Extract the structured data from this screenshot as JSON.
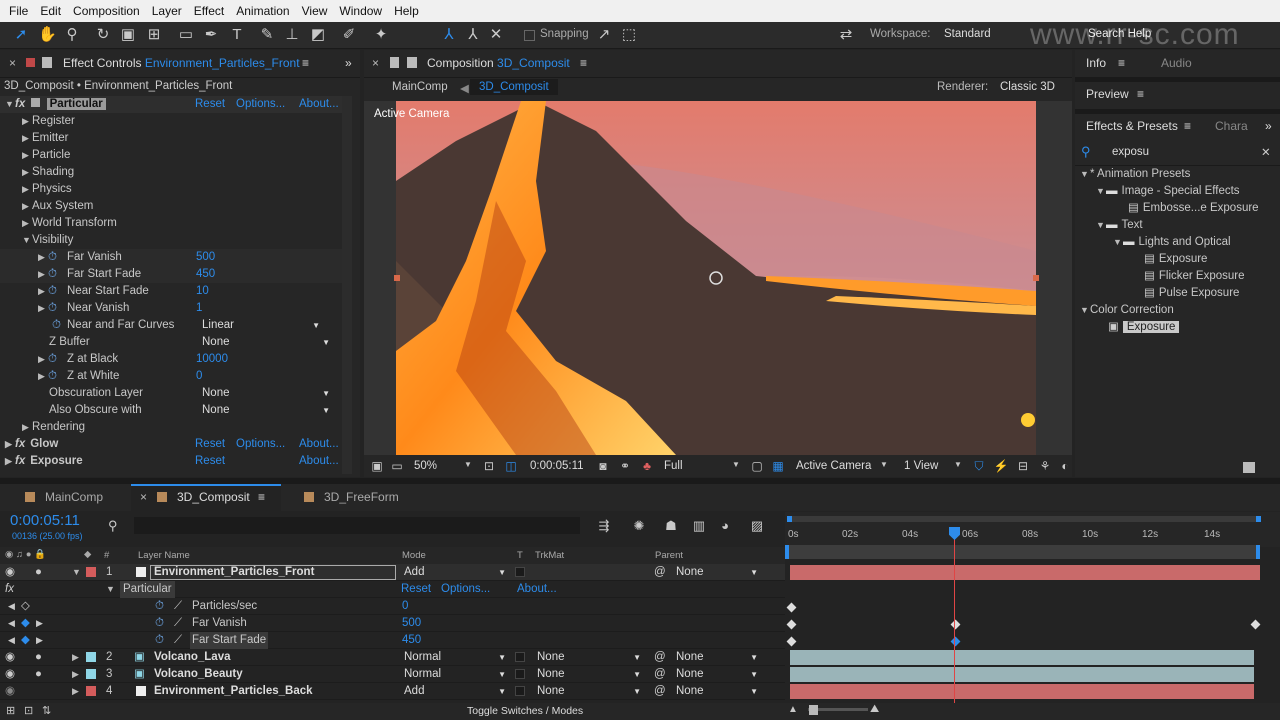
{
  "menu": [
    "File",
    "Edit",
    "Composition",
    "Layer",
    "Effect",
    "Animation",
    "View",
    "Window",
    "Help"
  ],
  "toolbar": {
    "snapping": "Snapping",
    "workspace_label": "Workspace:",
    "workspace_value": "Standard",
    "search_help": "Search Help"
  },
  "watermark": "www.rr-sc.com",
  "effect_controls": {
    "tab_prefix": "Effect Controls",
    "tab_layer": "Environment_Particles_Front",
    "breadcrumb": "3D_Composit • Environment_Particles_Front",
    "effect_name": "Particular",
    "reset": "Reset",
    "options": "Options...",
    "about": "About...",
    "groups": [
      "Register",
      "Emitter",
      "Particle",
      "Shading",
      "Physics",
      "Aux System",
      "World Transform",
      "Visibility"
    ],
    "visibility": [
      {
        "label": "Far Vanish",
        "value": "500"
      },
      {
        "label": "Far Start Fade",
        "value": "450"
      },
      {
        "label": "Near Start Fade",
        "value": "10"
      },
      {
        "label": "Near Vanish",
        "value": "1"
      },
      {
        "label": "Near and Far Curves",
        "value": "Linear"
      },
      {
        "label": "Z Buffer",
        "value": "None"
      },
      {
        "label": "Z at Black",
        "value": "10000"
      },
      {
        "label": "Z at White",
        "value": "0"
      },
      {
        "label": "Obscuration Layer",
        "value": "None"
      },
      {
        "label": "Also Obscure with",
        "value": "None"
      }
    ],
    "rendering": "Rendering",
    "glow": "Glow",
    "exposure": "Exposure"
  },
  "composition": {
    "tab_prefix": "Composition",
    "tab_name": "3D_Composit",
    "crumb1": "MainComp",
    "crumb2": "3D_Composit",
    "renderer_label": "Renderer:",
    "renderer_value": "Classic 3D",
    "active_camera": "Active Camera",
    "zoom": "50%",
    "timecode": "0:00:05:11",
    "resolution": "Full",
    "camera": "Active Camera",
    "views": "1 View"
  },
  "right": {
    "info": "Info",
    "audio": "Audio",
    "preview": "Preview",
    "effects_presets": "Effects & Presets",
    "char": "Chara",
    "search": "exposu",
    "tree": [
      {
        "t": "* Animation Presets",
        "d": 0,
        "k": "open"
      },
      {
        "t": "Image - Special Effects",
        "d": 1,
        "k": "folder"
      },
      {
        "t": "Embosse...e Exposure",
        "d": 2,
        "k": "file"
      },
      {
        "t": "Text",
        "d": 1,
        "k": "folder"
      },
      {
        "t": "Lights and Optical",
        "d": 2,
        "k": "folder"
      },
      {
        "t": "Exposure",
        "d": 3,
        "k": "file"
      },
      {
        "t": "Flicker Exposure",
        "d": 3,
        "k": "file"
      },
      {
        "t": "Pulse Exposure",
        "d": 3,
        "k": "file"
      },
      {
        "t": "Color Correction",
        "d": 0,
        "k": "open"
      },
      {
        "t": "Exposure",
        "d": 1,
        "k": "fx"
      }
    ]
  },
  "timeline": {
    "tabs": [
      "MainComp",
      "3D_Composit",
      "3D_FreeForm"
    ],
    "timecode": "0:00:05:11",
    "fps": "00136 (25.00 fps)",
    "headers": {
      "layer_name": "Layer Name",
      "mode": "Mode",
      "t": "T",
      "trkmat": "TrkMat",
      "parent": "Parent"
    },
    "ruler": [
      "0s",
      "02s",
      "04s",
      "06s",
      "08s",
      "10s",
      "12s",
      "14s"
    ],
    "layers": [
      {
        "num": "1",
        "name": "Environment_Particles_Front",
        "mode": "Add",
        "trkmat": "",
        "parent": "None",
        "color": "#d45c5c"
      },
      {
        "num": "2",
        "name": "Volcano_Lava",
        "mode": "Normal",
        "trkmat": "None",
        "parent": "None",
        "color": "#8fd6e6"
      },
      {
        "num": "3",
        "name": "Volcano_Beauty",
        "mode": "Normal",
        "trkmat": "None",
        "parent": "None",
        "color": "#8fd6e6"
      },
      {
        "num": "4",
        "name": "Environment_Particles_Back",
        "mode": "Add",
        "trkmat": "None",
        "parent": "None",
        "color": "#d45c5c"
      }
    ],
    "effect_row": {
      "name": "Particular",
      "reset": "Reset",
      "options": "Options...",
      "about": "About..."
    },
    "props": [
      {
        "name": "Particles/sec",
        "value": "0"
      },
      {
        "name": "Far Vanish",
        "value": "500"
      },
      {
        "name": "Far Start Fade",
        "value": "450"
      }
    ],
    "toggle": "Toggle Switches / Modes"
  },
  "colors": {
    "accent": "#2d8ceb",
    "label_red": "#d45c5c",
    "label_aqua": "#8fd6e6"
  }
}
